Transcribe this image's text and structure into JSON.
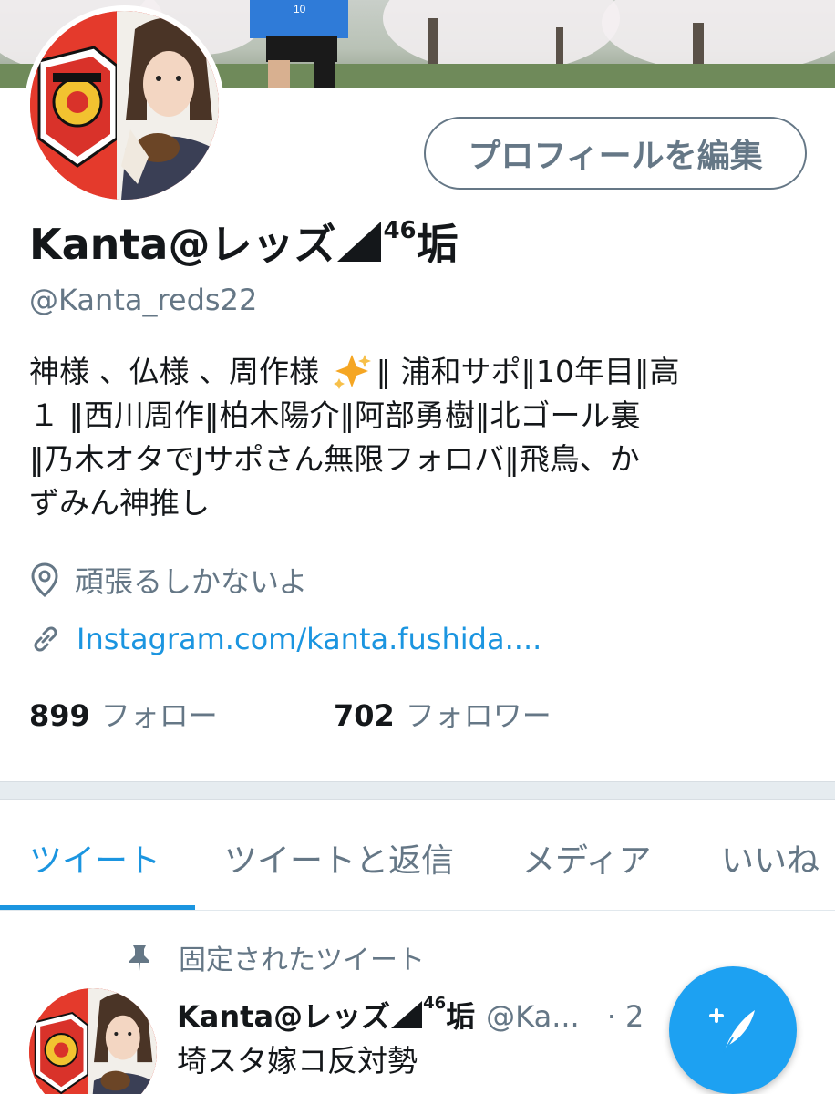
{
  "profile": {
    "edit_button": "プロフィールを編集",
    "name_prefix": "Kanta@レッズ",
    "name_suffix_sup": "46",
    "name_suffix": "垢",
    "handle": "@Kanta_reds22",
    "bio_line1_a": "神様 、仏様 、周作様 ",
    "bio_line1_b": "‖ 浦和サポ‖10年目‖高",
    "bio_line2": "１ ‖西川周作‖柏木陽介‖阿部勇樹‖北ゴール裏",
    "bio_line3": "‖乃木オタでJサポさん無限フォロバ‖飛鳥、か",
    "bio_line4": "ずみん神推し",
    "location": "頑張るしかないよ",
    "link": "Instagram.com/kanta.fushida....",
    "following_count": "899",
    "following_label": "フォロー",
    "followers_count": "702",
    "followers_label": "フォロワー"
  },
  "tabs": [
    {
      "label": "ツイート",
      "active": true
    },
    {
      "label": "ツイートと返信",
      "active": false
    },
    {
      "label": "メディア",
      "active": false
    },
    {
      "label": "いいね",
      "active": false
    }
  ],
  "pinned_tweet": {
    "pinned_label": "固定されたツイート",
    "name_prefix": "Kanta@レッズ",
    "name_suffix_sup": "46",
    "name_suffix": "垢",
    "handle": "@Ka...",
    "time": "· 2",
    "text": "埼スタ嫁コ反対勢"
  },
  "icons": {
    "location": "location-pin-icon",
    "link": "link-icon",
    "pin": "pin-icon",
    "compose": "compose-tweet-icon",
    "sparkle": "sparkles-icon"
  },
  "colors": {
    "accent": "#1b95e0",
    "fab": "#1da1f2",
    "muted": "#657786",
    "avatar_bg": "#e43a2c"
  }
}
